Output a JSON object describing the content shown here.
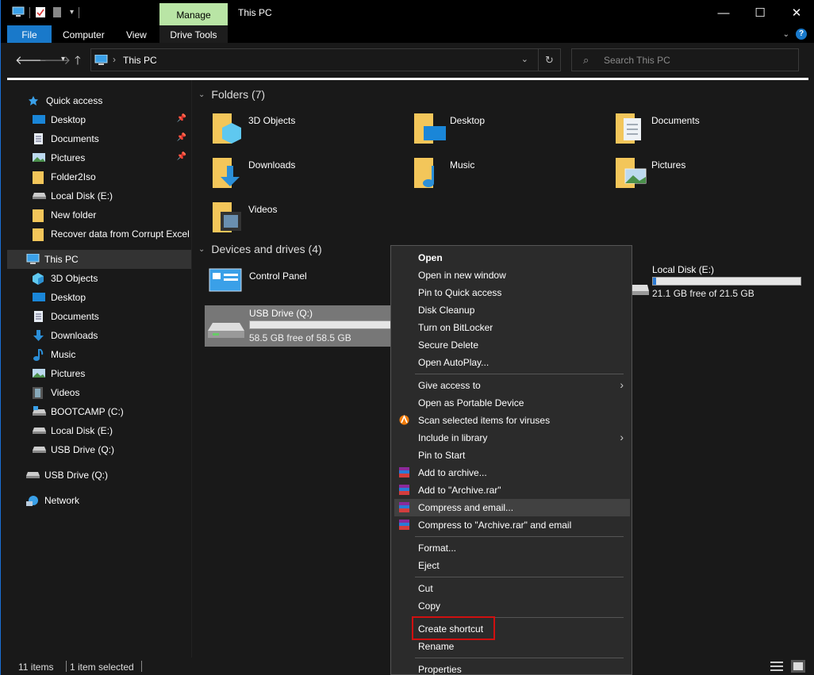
{
  "window": {
    "title": "This PC",
    "context_tab": "Manage",
    "tabs": [
      "File",
      "Computer",
      "View",
      "Drive Tools"
    ],
    "controls": {
      "minimize": "—",
      "maximize": "☐",
      "close": "✕"
    }
  },
  "address": {
    "path": "This PC",
    "search_placeholder": "Search This PC"
  },
  "nav": {
    "quick_access_label": "Quick access",
    "quick_access": [
      {
        "label": "Desktop",
        "icon": "desktop-icon",
        "pinned": true
      },
      {
        "label": "Documents",
        "icon": "documents-icon",
        "pinned": true
      },
      {
        "label": "Pictures",
        "icon": "pictures-icon",
        "pinned": true
      },
      {
        "label": "Folder2Iso",
        "icon": "folder-icon"
      },
      {
        "label": "Local Disk (E:)",
        "icon": "drive-icon"
      },
      {
        "label": "New folder",
        "icon": "folder-icon"
      },
      {
        "label": "Recover data from Corrupt Excel f",
        "icon": "folder-icon"
      }
    ],
    "this_pc_label": "This PC",
    "this_pc": [
      {
        "label": "3D Objects",
        "icon": "3d-objects-icon"
      },
      {
        "label": "Desktop",
        "icon": "desktop-icon"
      },
      {
        "label": "Documents",
        "icon": "documents-icon"
      },
      {
        "label": "Downloads",
        "icon": "downloads-icon"
      },
      {
        "label": "Music",
        "icon": "music-icon"
      },
      {
        "label": "Pictures",
        "icon": "pictures-icon"
      },
      {
        "label": "Videos",
        "icon": "videos-icon"
      },
      {
        "label": "BOOTCAMP (C:)",
        "icon": "drive-icon"
      },
      {
        "label": "Local Disk (E:)",
        "icon": "drive-icon"
      },
      {
        "label": "USB Drive (Q:)",
        "icon": "usb-drive-icon"
      }
    ],
    "usb_label": "USB Drive (Q:)",
    "network_label": "Network"
  },
  "content": {
    "folders_header": "Folders (7)",
    "folders": [
      "3D Objects",
      "Desktop",
      "Documents",
      "Downloads",
      "Music",
      "Pictures",
      "Videos"
    ],
    "devices_header": "Devices and drives (4)",
    "control_panel": "Control Panel",
    "usb": {
      "name": "USB Drive (Q:)",
      "free": "58.5 GB free of 58.5 GB",
      "used_fraction": 0.0
    },
    "local_e": {
      "name": "Local Disk (E:)",
      "free": "21.1 GB free of 21.5 GB",
      "used_fraction": 0.02
    }
  },
  "context_menu": {
    "items": [
      "Open",
      "Open in new window",
      "Pin to Quick access",
      "Disk Cleanup",
      "Turn on BitLocker",
      "Secure Delete",
      "Open AutoPlay...",
      "Give access to",
      "Open as Portable Device",
      "Scan selected items for viruses",
      "Include in library",
      "Pin to Start",
      "Add to archive...",
      "Add to \"Archive.rar\"",
      "Compress and email...",
      "Compress to \"Archive.rar\" and email",
      "Format...",
      "Eject",
      "Cut",
      "Copy",
      "Create shortcut",
      "Rename",
      "Properties"
    ],
    "highlighted": "Compress and email...",
    "outlined": "Create shortcut"
  },
  "status": {
    "items": "11 items",
    "selected": "1 item selected"
  }
}
